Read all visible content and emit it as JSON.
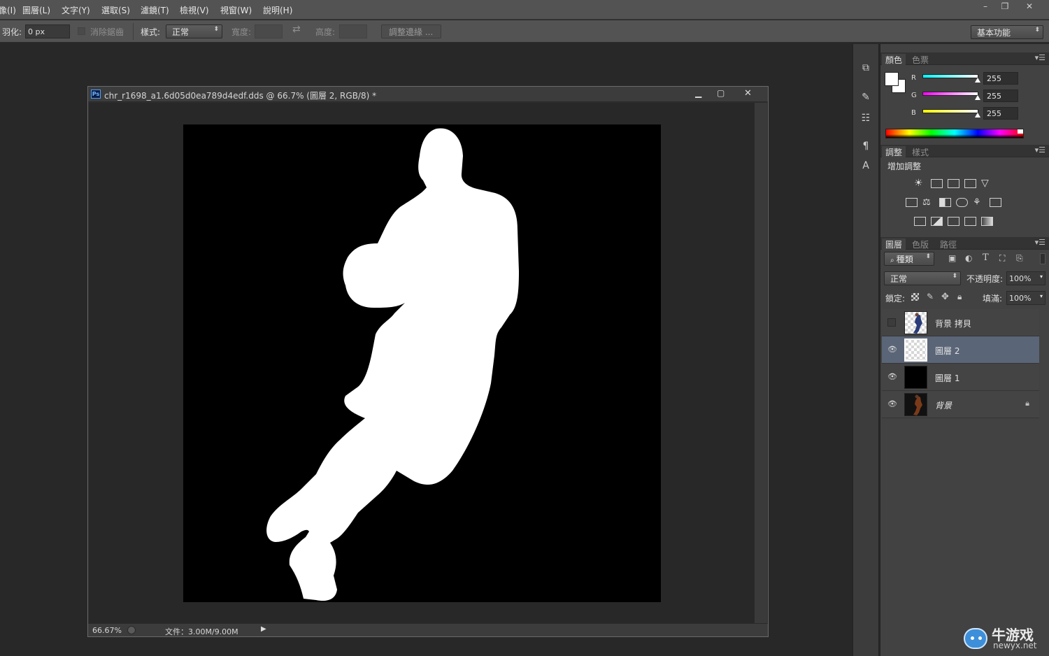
{
  "menubar": {
    "items": [
      "像(I)",
      "圖層(L)",
      "文字(Y)",
      "選取(S)",
      "濾鏡(T)",
      "檢視(V)",
      "視窗(W)",
      "說明(H)"
    ]
  },
  "window_controls": {
    "minimize": "–",
    "restore": "❐",
    "close": "✕"
  },
  "options": {
    "feather_label": "羽化:",
    "feather_value": "0 px",
    "antialias_label": "消除鋸齒",
    "style_label": "樣式:",
    "style_value": "正常",
    "width_label": "寬度:",
    "height_label": "高度:",
    "refine_edge_button": "調整邊緣 ...",
    "workspace_value": "基本功能"
  },
  "document": {
    "title": "chr_r1698_a1.6d05d0ea789d4edf.dds @ 66.7% (圖層 2, RGB/8) *",
    "zoom": "66.67%",
    "doc_size": "文件：3.00M/9.00M"
  },
  "color_panel": {
    "tabs": [
      "顏色",
      "色票"
    ],
    "channels": [
      {
        "label": "R",
        "value": "255",
        "gradient": "linear-gradient(90deg,#00ffff,#ffffff)"
      },
      {
        "label": "G",
        "value": "255",
        "gradient": "linear-gradient(90deg,#ff00ff,#ffffff)"
      },
      {
        "label": "B",
        "value": "255",
        "gradient": "linear-gradient(90deg,#ffff00,#ffffff)"
      }
    ]
  },
  "adjustments_panel": {
    "tabs": [
      "調整",
      "樣式"
    ],
    "heading": "增加調整"
  },
  "layers_panel": {
    "tabs": [
      "圖層",
      "色版",
      "路徑"
    ],
    "filter_kind": "種類",
    "blend_mode": "正常",
    "opacity_label": "不透明度:",
    "opacity_value": "100%",
    "lock_label": "鎖定:",
    "fill_label": "填滿:",
    "fill_value": "100%",
    "layers": [
      {
        "name": "背景 拷貝",
        "visible": false,
        "selected": false,
        "locked": false
      },
      {
        "name": "圖層 2",
        "visible": true,
        "selected": true,
        "locked": false
      },
      {
        "name": "圖層 1",
        "visible": true,
        "selected": false,
        "locked": false
      },
      {
        "name": "背景",
        "visible": true,
        "selected": false,
        "locked": true
      }
    ]
  },
  "watermark": {
    "brand": "牛游戏",
    "domain": "newyx.net"
  },
  "colors": {
    "accent_selected_layer": "#5a6577",
    "ui_dark": "#282828",
    "ui_mid": "#535353"
  }
}
